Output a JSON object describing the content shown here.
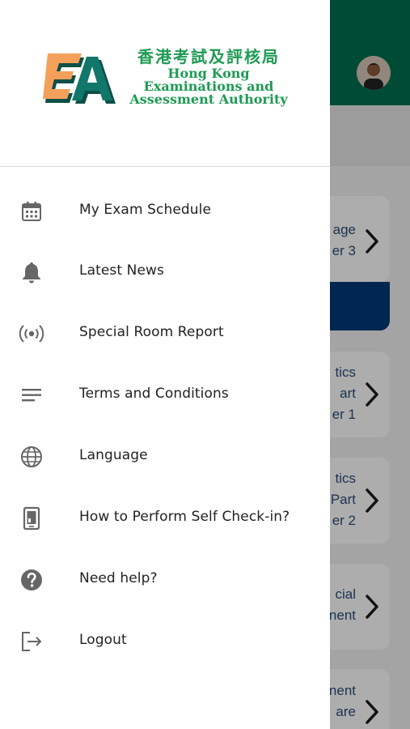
{
  "brand": {
    "name_zh": "香港考試及評核局",
    "name_en_line1": "Hong Kong",
    "name_en_line2": "Examinations and",
    "name_en_line3": "Assessment Authority",
    "colors": {
      "green": "#1d9b52",
      "orange": "#f5a05a",
      "teal": "#11776a"
    }
  },
  "drawer": {
    "items": [
      {
        "icon": "calendar-icon",
        "label": "My Exam Schedule"
      },
      {
        "icon": "bell-icon",
        "label": "Latest News"
      },
      {
        "icon": "broadcast-icon",
        "label": "Special Room Report"
      },
      {
        "icon": "list-lines-icon",
        "label": "Terms and Conditions"
      },
      {
        "icon": "globe-icon",
        "label": "Language"
      },
      {
        "icon": "phone-checkin-icon",
        "label": "How to Perform Self Check-in?"
      },
      {
        "icon": "help-circle-icon",
        "label": "Need help?"
      },
      {
        "icon": "logout-icon",
        "label": "Logout"
      }
    ]
  },
  "background": {
    "header_color": "#006f4f",
    "cards": [
      {
        "lines": [
          "age",
          "er 3"
        ]
      },
      {
        "lines": [
          "tics",
          "art",
          "er 1"
        ]
      },
      {
        "lines": [
          "tics",
          "Part",
          "er 2"
        ]
      },
      {
        "lines": [
          "cial",
          "nent"
        ]
      },
      {
        "lines": [
          "nent",
          "are"
        ]
      }
    ]
  }
}
